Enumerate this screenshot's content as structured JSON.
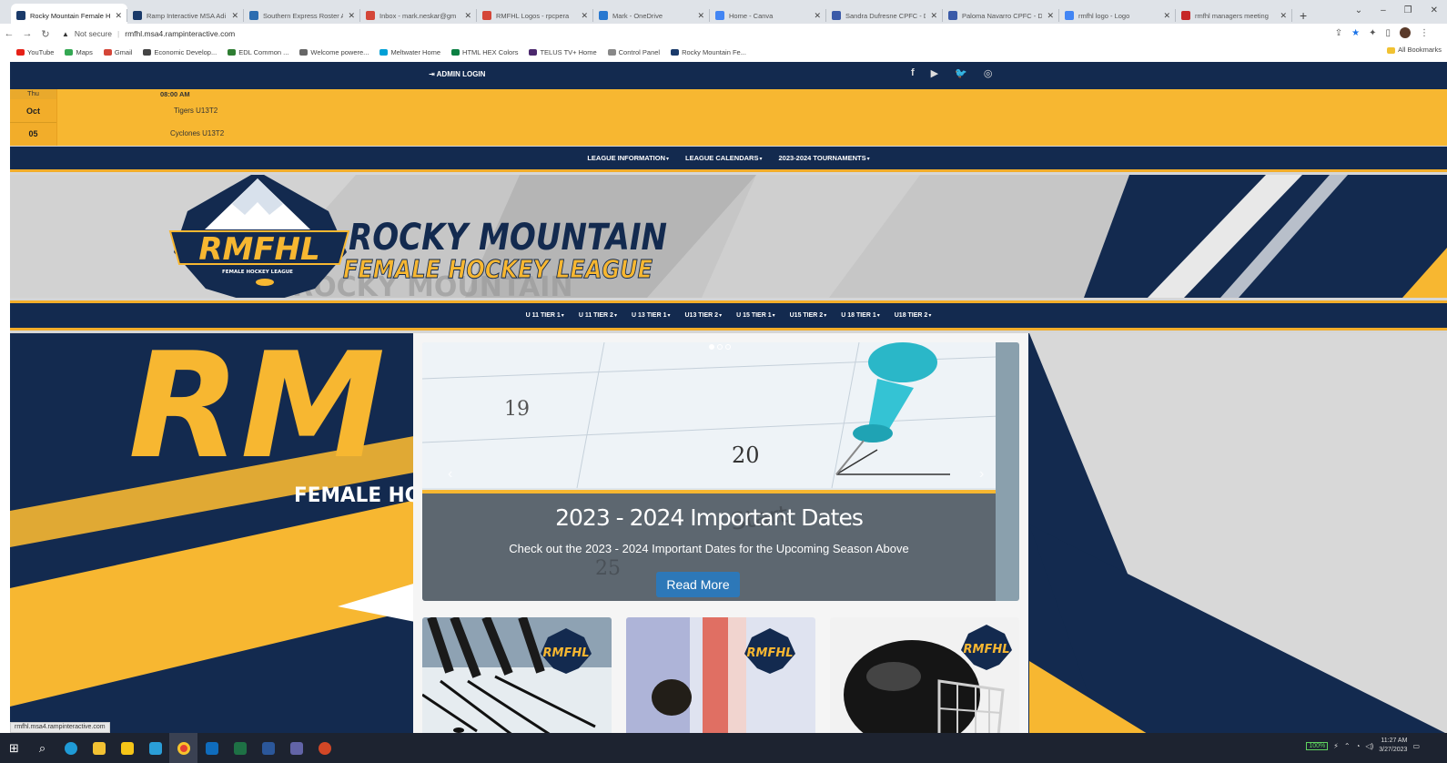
{
  "browser": {
    "tabs": [
      {
        "title": "Rocky Mountain Female H",
        "icon": "ramp-favicon-icon",
        "color": "#1a3a6a",
        "active": true
      },
      {
        "title": "Ramp Interactive MSA Adi",
        "icon": "ramp-favicon-icon",
        "color": "#1a3a6a"
      },
      {
        "title": "Southern Express Roster A",
        "icon": "roster-favicon-icon",
        "color": "#2b6cb0"
      },
      {
        "title": "Inbox - mark.neskar@gm",
        "icon": "gmail-icon",
        "color": "#d44638"
      },
      {
        "title": "RMFHL Logos - rpcpera",
        "icon": "gmail-icon",
        "color": "#d44638"
      },
      {
        "title": "Mark - OneDrive",
        "icon": "onedrive-icon",
        "color": "#2878d0"
      },
      {
        "title": "Home - Canva",
        "icon": "google-icon",
        "color": "#4285f4"
      },
      {
        "title": "Sandra Dufresne CPFC - D",
        "icon": "printer-icon",
        "color": "#3a5aa8"
      },
      {
        "title": "Paloma Navarro CPFC - D",
        "icon": "printer-icon",
        "color": "#3a5aa8"
      },
      {
        "title": "rmfhl logo - Logo",
        "icon": "google-icon",
        "color": "#4285f4"
      },
      {
        "title": "rmfhl managers meeting",
        "icon": "pdf-icon",
        "color": "#c62828"
      }
    ],
    "new_tab": "+",
    "window_controls": [
      "⌄",
      "–",
      "❐",
      "✕"
    ],
    "address": {
      "security": "Not secure",
      "url": "rmfhl.msa4.rampinteractive.com"
    },
    "bookmarks": [
      {
        "label": "YouTube",
        "color": "#e62117"
      },
      {
        "label": "Maps",
        "color": "#34a853"
      },
      {
        "label": "Gmail",
        "color": "#d44638"
      },
      {
        "label": "Economic Develop...",
        "color": "#444444"
      },
      {
        "label": "EDL Common ...",
        "color": "#2e7d32"
      },
      {
        "label": "Welcome powere...",
        "color": "#666666"
      },
      {
        "label": "Meltwater Home",
        "color": "#00a0d6"
      },
      {
        "label": "HTML HEX Colors",
        "color": "#0b8043"
      },
      {
        "label": "TELUS TV+ Home",
        "color": "#4b286d"
      },
      {
        "label": "Control Panel",
        "color": "#888888"
      },
      {
        "label": "Rocky Mountain Fe...",
        "color": "#1a3a6a"
      }
    ],
    "all_bookmarks": "All Bookmarks",
    "status_url": "rmfhl.msa4.rampinteractive.com"
  },
  "site": {
    "admin_login": "ADMIN LOGIN",
    "social": [
      "f",
      "▶",
      "🐦",
      "◎"
    ],
    "ticker": {
      "day": "Thu",
      "month": "Oct",
      "date": "05",
      "time": "08:00 AM",
      "team1": "Tigers U13T2",
      "team2": "Cyclones U13T2"
    },
    "main_nav": [
      "LEAGUE INFORMATION",
      "LEAGUE CALENDARS",
      "2023-2024 TOURNAMENTS"
    ],
    "logo": {
      "badge_top": "ROCKY MOUNTAIN",
      "badge_main": "RMFHL",
      "badge_bottom": "FEMALE HOCKEY LEAGUE",
      "title_line1": "ROCKY MOUNTAIN",
      "title_line2": "FEMALE HOCKEY LEAGUE",
      "shadow": "ROCKY MOUNTAIN"
    },
    "sub_nav": [
      "U 11 TIER 1",
      "U 11 TIER 2",
      "U 13 TIER 1",
      "U13 TIER 2",
      "U 15 TIER 1",
      "U15 TIER 2",
      "U 18 TIER 1",
      "U18 TIER 2"
    ],
    "hero": {
      "big_letters": "RM",
      "subtitle": "FEMALE HO"
    },
    "slide": {
      "title": "2023 - 2024 Important Dates",
      "text": "Check out the 2023 - 2024 Important Dates for the Upcoming Season Above",
      "button": "Read More",
      "cal_19": "19",
      "cal_20": "20",
      "cal_25": "25"
    },
    "cards": [
      {
        "logo": "RMFHL",
        "scene": "hockey sticks on ice"
      },
      {
        "logo": "RMFHL",
        "scene": "puck on red line"
      },
      {
        "logo": "RMFHL",
        "scene": "hockey helmet"
      }
    ]
  },
  "taskbar": {
    "battery": "100%",
    "time": "11:27 AM",
    "date": "3/27/2023"
  },
  "colors": {
    "navy": "#132a4f",
    "gold": "#f7b731",
    "button": "#2d78b8"
  }
}
